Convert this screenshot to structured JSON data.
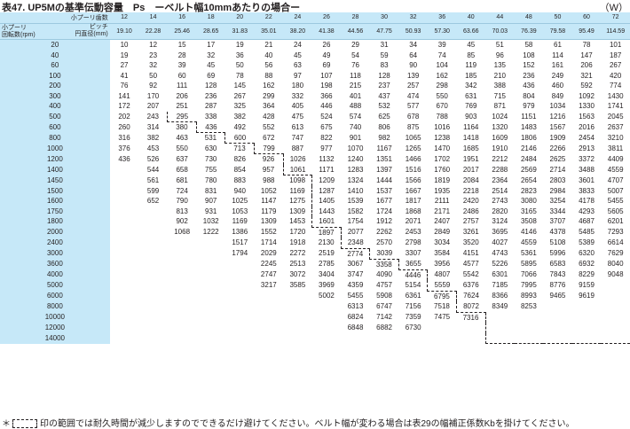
{
  "title": "表47. UP5Mの基準伝動容量　Ps　ーベルト幅10mmあたりの場合ー",
  "unit": "（W）",
  "header": {
    "teeth_label": "小プーリ歯数",
    "pitch_label_1": "ピッチ",
    "pitch_label_2": "円直径(mm)",
    "rpm_label_1": "小プーリ",
    "rpm_label_2": "回転数(rpm)"
  },
  "teeth": [
    "12",
    "14",
    "16",
    "18",
    "20",
    "22",
    "24",
    "26",
    "28",
    "30",
    "32",
    "36",
    "40",
    "44",
    "48",
    "50",
    "60",
    "72"
  ],
  "pitch": [
    "19.10",
    "22.28",
    "25.46",
    "28.65",
    "31.83",
    "35.01",
    "38.20",
    "41.38",
    "44.56",
    "47.75",
    "50.93",
    "57.30",
    "63.66",
    "70.03",
    "76.39",
    "79.58",
    "95.49",
    "114.59"
  ],
  "rows": [
    {
      "rpm": "20",
      "v": [
        "10",
        "12",
        "15",
        "17",
        "19",
        "21",
        "24",
        "26",
        "29",
        "31",
        "34",
        "39",
        "45",
        "51",
        "58",
        "61",
        "78",
        "101"
      ]
    },
    {
      "rpm": "40",
      "v": [
        "19",
        "23",
        "28",
        "32",
        "36",
        "40",
        "45",
        "49",
        "54",
        "59",
        "64",
        "74",
        "85",
        "96",
        "108",
        "114",
        "147",
        "187"
      ]
    },
    {
      "rpm": "60",
      "v": [
        "27",
        "32",
        "39",
        "45",
        "50",
        "56",
        "63",
        "69",
        "76",
        "83",
        "90",
        "104",
        "119",
        "135",
        "152",
        "161",
        "206",
        "267"
      ]
    },
    {
      "rpm": "100",
      "v": [
        "41",
        "50",
        "60",
        "69",
        "78",
        "88",
        "97",
        "107",
        "118",
        "128",
        "139",
        "162",
        "185",
        "210",
        "236",
        "249",
        "321",
        "420"
      ]
    },
    {
      "rpm": "200",
      "v": [
        "76",
        "92",
        "111",
        "128",
        "145",
        "162",
        "180",
        "198",
        "215",
        "237",
        "257",
        "298",
        "342",
        "388",
        "436",
        "460",
        "592",
        "774"
      ]
    },
    {
      "rpm": "300",
      "v": [
        "141",
        "170",
        "206",
        "236",
        "267",
        "299",
        "332",
        "366",
        "401",
        "437",
        "474",
        "550",
        "631",
        "715",
        "804",
        "849",
        "1092",
        "1430"
      ]
    },
    {
      "rpm": "400",
      "v": [
        "172",
        "207",
        "251",
        "287",
        "325",
        "364",
        "405",
        "446",
        "488",
        "532",
        "577",
        "670",
        "769",
        "871",
        "979",
        "1034",
        "1330",
        "1741"
      ]
    },
    {
      "rpm": "500",
      "v": [
        "202",
        "243",
        "295",
        "338",
        "382",
        "428",
        "475",
        "524",
        "574",
        "625",
        "678",
        "788",
        "903",
        "1024",
        "1151",
        "1216",
        "1563",
        "2045"
      ]
    },
    {
      "rpm": "600",
      "v": [
        "260",
        "314",
        "380",
        "436",
        "492",
        "552",
        "613",
        "675",
        "740",
        "806",
        "875",
        "1016",
        "1164",
        "1320",
        "1483",
        "1567",
        "2016",
        "2637"
      ]
    },
    {
      "rpm": "800",
      "v": [
        "316",
        "382",
        "463",
        "531",
        "600",
        "672",
        "747",
        "822",
        "901",
        "982",
        "1065",
        "1238",
        "1418",
        "1609",
        "1806",
        "1909",
        "2454",
        "3210"
      ]
    },
    {
      "rpm": "1000",
      "v": [
        "376",
        "453",
        "550",
        "630",
        "713",
        "799",
        "887",
        "977",
        "1070",
        "1167",
        "1265",
        "1470",
        "1685",
        "1910",
        "2146",
        "2266",
        "2913",
        "3811"
      ]
    },
    {
      "rpm": "1200",
      "v": [
        "436",
        "526",
        "637",
        "730",
        "826",
        "926",
        "1026",
        "1132",
        "1240",
        "1351",
        "1466",
        "1702",
        "1951",
        "2212",
        "2484",
        "2625",
        "3372",
        "4409"
      ]
    },
    {
      "rpm": "1400",
      "v": [
        "",
        "544",
        "658",
        "755",
        "854",
        "957",
        "1061",
        "1171",
        "1283",
        "1397",
        "1516",
        "1760",
        "2017",
        "2288",
        "2569",
        "2714",
        "3488",
        "4559"
      ]
    },
    {
      "rpm": "1450",
      "v": [
        "",
        "561",
        "681",
        "780",
        "883",
        "988",
        "1098",
        "1209",
        "1324",
        "1444",
        "1566",
        "1819",
        "2084",
        "2364",
        "2654",
        "2803",
        "3601",
        "4707"
      ]
    },
    {
      "rpm": "1500",
      "v": [
        "",
        "599",
        "724",
        "831",
        "940",
        "1052",
        "1169",
        "1287",
        "1410",
        "1537",
        "1667",
        "1935",
        "2218",
        "2514",
        "2823",
        "2984",
        "3833",
        "5007"
      ]
    },
    {
      "rpm": "1600",
      "v": [
        "",
        "652",
        "790",
        "907",
        "1025",
        "1147",
        "1275",
        "1405",
        "1539",
        "1677",
        "1817",
        "2111",
        "2420",
        "2743",
        "3080",
        "3254",
        "4178",
        "5455"
      ]
    },
    {
      "rpm": "1750",
      "v": [
        "",
        "",
        "813",
        "931",
        "1053",
        "1179",
        "1309",
        "1443",
        "1582",
        "1724",
        "1868",
        "2171",
        "2486",
        "2820",
        "3165",
        "3344",
        "4293",
        "5605"
      ]
    },
    {
      "rpm": "1800",
      "v": [
        "",
        "",
        "902",
        "1032",
        "1169",
        "1309",
        "1453",
        "1601",
        "1754",
        "1912",
        "2071",
        "2407",
        "2757",
        "3124",
        "3508",
        "3707",
        "4687",
        "6201"
      ]
    },
    {
      "rpm": "2000",
      "v": [
        "",
        "",
        "1068",
        "1222",
        "1386",
        "1552",
        "1720",
        "1897",
        "2077",
        "2262",
        "2453",
        "2849",
        "3261",
        "3695",
        "4146",
        "4378",
        "5485",
        "7293"
      ]
    },
    {
      "rpm": "2400",
      "v": [
        "",
        "",
        "",
        "",
        "1517",
        "1714",
        "1918",
        "2130",
        "2348",
        "2570",
        "2798",
        "3034",
        "3520",
        "4027",
        "4559",
        "5108",
        "5389",
        "6614"
      ]
    },
    {
      "rpm": "3000",
      "v": [
        "",
        "",
        "",
        "",
        "1794",
        "2029",
        "2272",
        "2519",
        "2774",
        "3039",
        "3307",
        "3584",
        "4151",
        "4743",
        "5361",
        "5996",
        "6320",
        "7629"
      ]
    },
    {
      "rpm": "3600",
      "v": [
        "",
        "",
        "",
        "",
        "",
        "2245",
        "2513",
        "2785",
        "3067",
        "3358",
        "3655",
        "3956",
        "4577",
        "5226",
        "5895",
        "6583",
        "6932",
        "8040"
      ]
    },
    {
      "rpm": "4000",
      "v": [
        "",
        "",
        "",
        "",
        "",
        "2747",
        "3072",
        "3404",
        "3747",
        "4090",
        "4446",
        "4807",
        "5542",
        "6301",
        "7066",
        "7843",
        "8229",
        "9048"
      ]
    },
    {
      "rpm": "5000",
      "v": [
        "",
        "",
        "",
        "",
        "",
        "3217",
        "3585",
        "3969",
        "4359",
        "4757",
        "5154",
        "5559",
        "6376",
        "7185",
        "7995",
        "8776",
        "9159",
        ""
      ]
    },
    {
      "rpm": "6000",
      "v": [
        "",
        "",
        "",
        "",
        "",
        "",
        "",
        "5002",
        "5455",
        "5908",
        "6361",
        "6795",
        "7624",
        "8366",
        "8993",
        "9465",
        "9619",
        ""
      ]
    },
    {
      "rpm": "8000",
      "v": [
        "",
        "",
        "",
        "",
        "",
        "",
        "",
        "",
        "6313",
        "6747",
        "7156",
        "7518",
        "8072",
        "8349",
        "8253",
        "",
        "",
        ""
      ]
    },
    {
      "rpm": "10000",
      "v": [
        "",
        "",
        "",
        "",
        "",
        "",
        "",
        "",
        "6824",
        "7142",
        "7359",
        "7475",
        "7316",
        "",
        "",
        "",
        "",
        ""
      ]
    },
    {
      "rpm": "12000",
      "v": [
        "",
        "",
        "",
        "",
        "",
        "",
        "",
        "",
        "6848",
        "6882",
        "6730",
        "",
        "",
        "",
        "",
        "",
        "",
        ""
      ]
    },
    {
      "rpm": "14000",
      "v": [
        "",
        "",
        "",
        "",
        "",
        "",
        "",
        "",
        "",
        "",
        "",
        "",
        "",
        "",
        "",
        "",
        "",
        ""
      ]
    }
  ],
  "footnote_pre": "＊",
  "footnote_text": "印の範囲では耐久時間が減少しますのでできるだけ避けてください。ベルト幅が変わる場合は表29の幅補正係数Kbを掛けてください。"
}
